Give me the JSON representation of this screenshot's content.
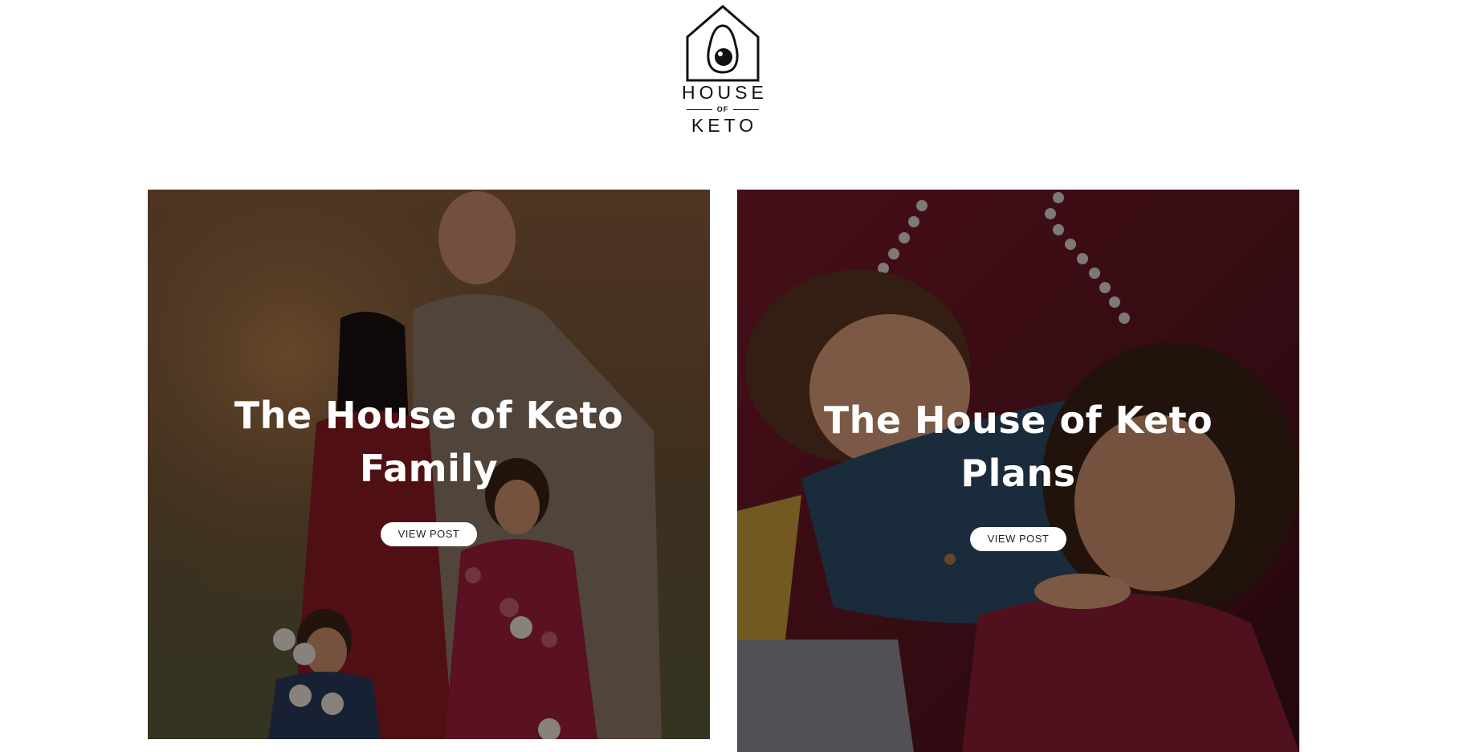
{
  "logo": {
    "line1": "HOUSE",
    "line2": "OF",
    "line3": "KETO",
    "icon": "avocado-house-icon"
  },
  "cards": [
    {
      "title": "The House of Keto Family",
      "button_label": "VIEW POST",
      "image": "family-portrait-photo"
    },
    {
      "title": "The House of Keto Plans",
      "button_label": "VIEW POST",
      "image": "children-hugging-photo"
    }
  ],
  "colors": {
    "background": "#ffffff",
    "logo": "#111111",
    "overlay": "rgba(0,0,0,0.42)",
    "button_bg": "#ffffff",
    "title_text": "#ffffff"
  }
}
